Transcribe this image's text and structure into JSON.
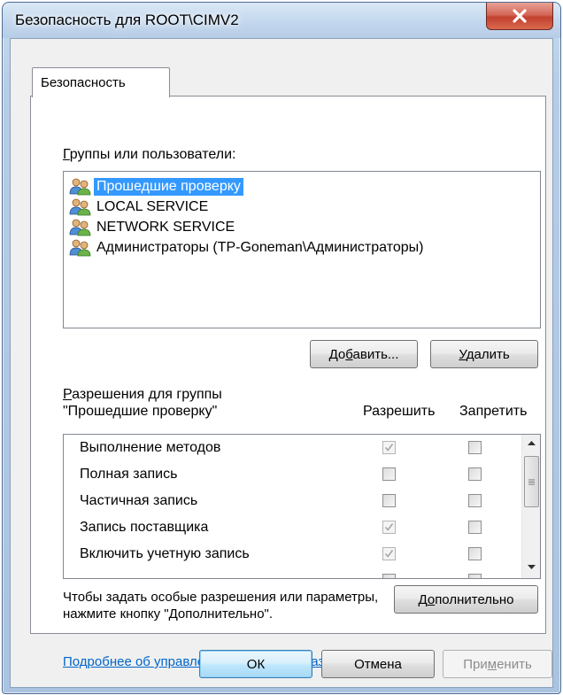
{
  "window": {
    "title": "Безопасность для ROOT\\CIMV2"
  },
  "tabs": [
    {
      "label": "Безопасность",
      "active": true
    }
  ],
  "groups": {
    "label": "Группы или пользователи:",
    "items": [
      {
        "name": "Прошедшие проверку",
        "selected": true
      },
      {
        "name": "LOCAL SERVICE",
        "selected": false
      },
      {
        "name": "NETWORK SERVICE",
        "selected": false
      },
      {
        "name": "Администраторы (TP-Goneman\\Администраторы)",
        "selected": false
      }
    ],
    "add_button": "Добавить...",
    "remove_button": "Удалить"
  },
  "permissions": {
    "label_line1": "Разрешения для группы",
    "label_line2": "\"Прошедшие проверку\"",
    "allow_header": "Разрешить",
    "deny_header": "Запретить",
    "rows": [
      {
        "name": "Выполнение методов",
        "allow": true,
        "deny": false
      },
      {
        "name": "Полная запись",
        "allow": false,
        "deny": false
      },
      {
        "name": "Частичная запись",
        "allow": false,
        "deny": false
      },
      {
        "name": "Запись поставщика",
        "allow": true,
        "deny": false
      },
      {
        "name": "Включить учетную запись",
        "allow": true,
        "deny": false
      }
    ]
  },
  "advanced": {
    "help_text": "Чтобы задать особые разрешения или параметры, нажмите кнопку \"Дополнительно\".",
    "button": "Дополнительно"
  },
  "link": {
    "text": "Подробнее об управлении доступом и разрешениях"
  },
  "footer": {
    "ok": "ОК",
    "cancel": "Отмена",
    "apply": "Применить"
  },
  "colors": {
    "selection": "#3399ff",
    "link": "#0066cc",
    "close_button": "#c2412f"
  },
  "icons": [
    "close-icon",
    "user-group-icon",
    "checkmark-icon",
    "scroll-up-icon",
    "scroll-down-icon"
  ]
}
